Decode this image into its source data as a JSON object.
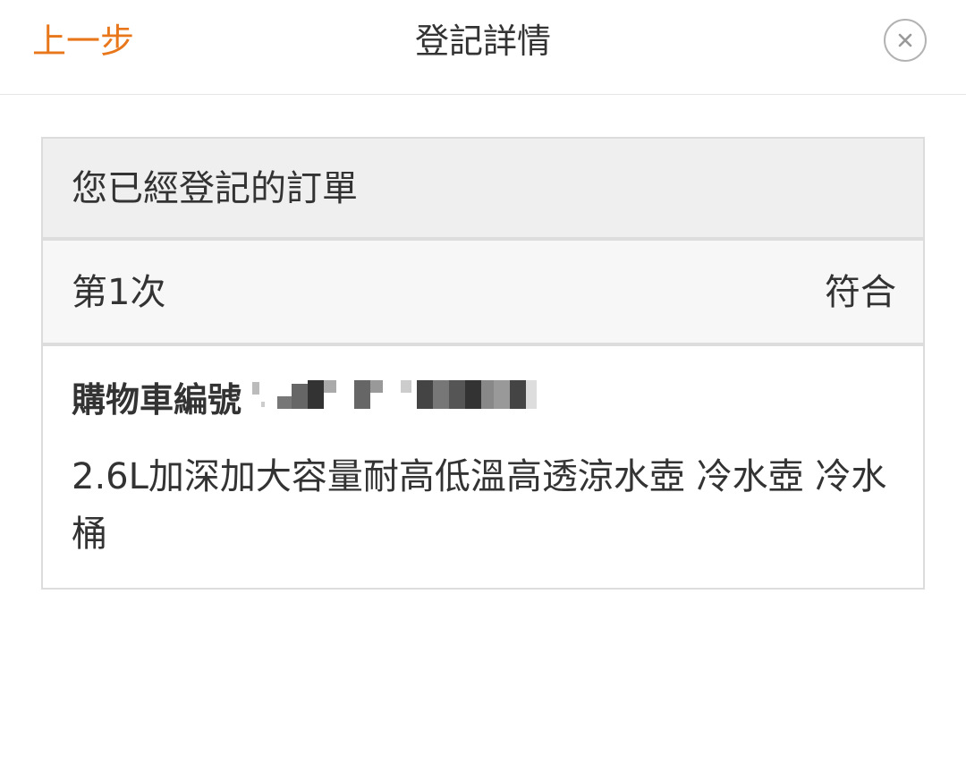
{
  "header": {
    "back_label": "上一步",
    "title": "登記詳情",
    "close_icon": "close-circle-icon"
  },
  "card": {
    "title": "您已經登記的訂單",
    "entry": {
      "count_label": "第1次",
      "status": "符合"
    },
    "cart": {
      "label": "購物車編號",
      "value_redacted": true
    },
    "product_name": "2.6L加深加大容量耐高低溫高透涼水壺 冷水壺 冷水桶"
  },
  "colors": {
    "accent": "#e8771b",
    "text": "#333333",
    "header_bg": "#efefef",
    "row_bg": "#f7f7f7",
    "border": "#dcdcdc"
  }
}
